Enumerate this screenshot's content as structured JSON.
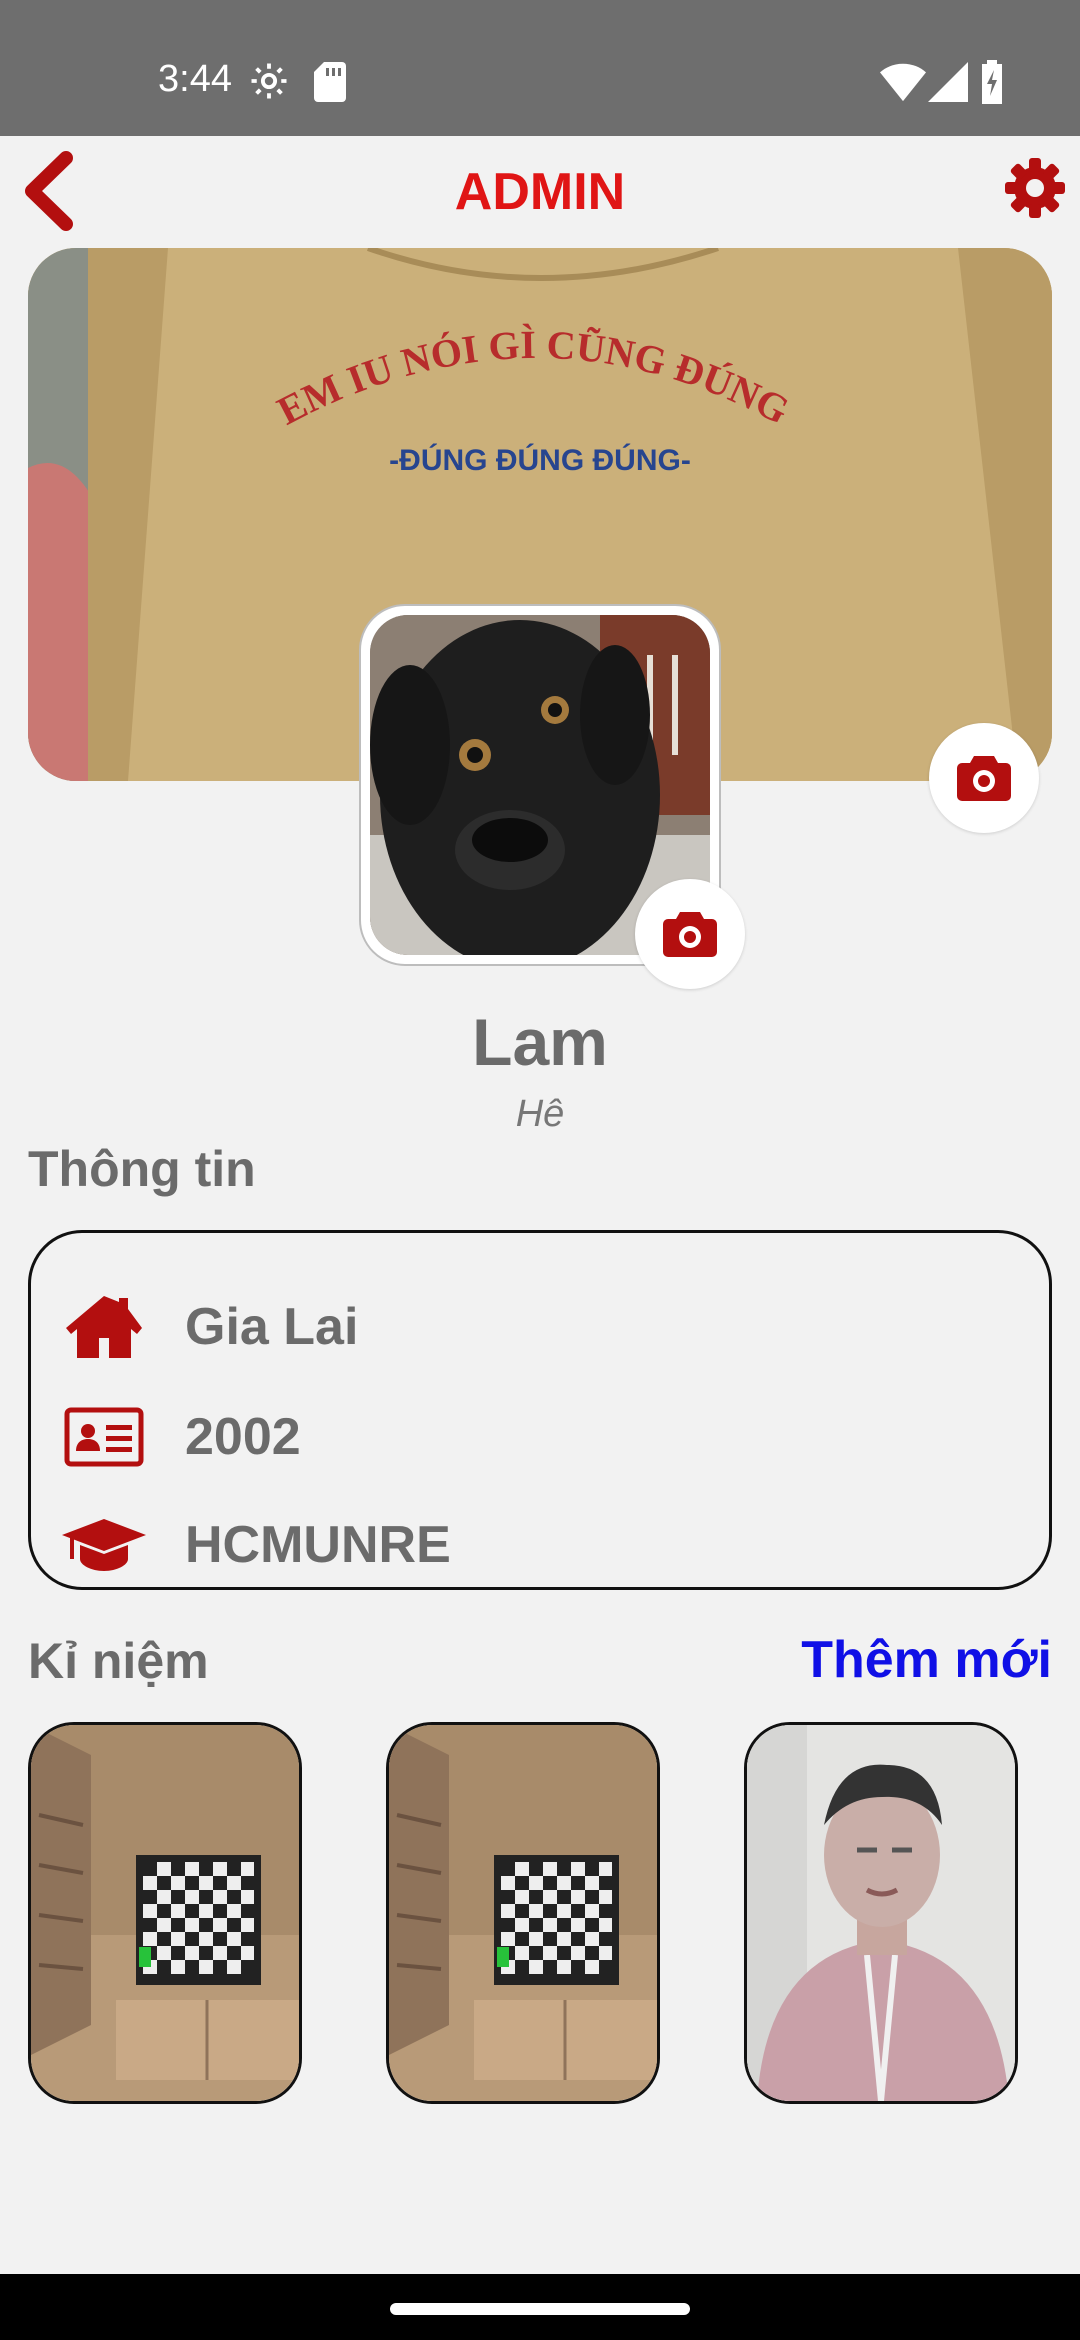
{
  "status_bar": {
    "time": "3:44",
    "icons": [
      "settings-gear-icon",
      "sd-card-icon",
      "wifi-icon",
      "cell-signal-icon",
      "battery-charging-icon"
    ]
  },
  "header": {
    "title": "ADMIN",
    "back_icon": "chevron-left-icon",
    "settings_icon": "gear-icon",
    "accent_color": "#e01515",
    "icon_color": "#b30f0f"
  },
  "cover": {
    "shirt_text_line1": "EM IU NÓI GÌ CŨNG ĐÚNG",
    "shirt_text_line2": "-ĐÚNG ĐÚNG ĐÚNG-",
    "camera_icon": "camera-icon"
  },
  "profile": {
    "name": "Lam",
    "subtitle": "Hê"
  },
  "info": {
    "title": "Thông tin",
    "items": [
      {
        "icon": "home-icon",
        "text": "Gia Lai"
      },
      {
        "icon": "id-card-icon",
        "text": "2002"
      },
      {
        "icon": "graduation-cap-icon",
        "text": "HCMUNRE"
      }
    ]
  },
  "memories": {
    "title": "Kỉ niệm",
    "add_label": "Thêm mới",
    "add_color": "#1010e6",
    "items": [
      {
        "kind": "room-tv-photo"
      },
      {
        "kind": "room-tv-photo"
      },
      {
        "kind": "person-photo"
      }
    ]
  }
}
